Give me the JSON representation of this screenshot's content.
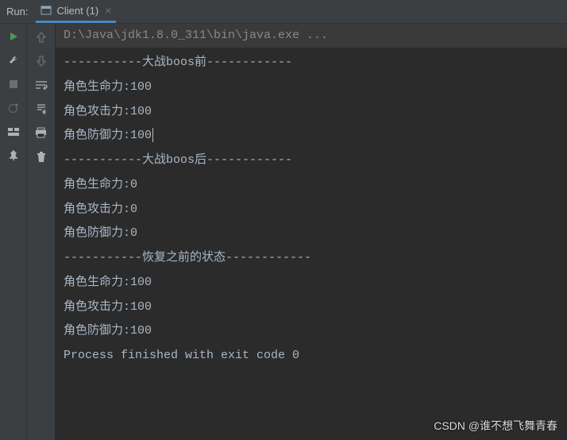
{
  "header": {
    "run_label": "Run:",
    "tab_label": "Client (1)",
    "tab_close": "×"
  },
  "console": {
    "command": "D:\\Java\\jdk1.8.0_311\\bin\\java.exe ...",
    "lines": [
      "-----------大战boos前------------",
      "角色生命力:100",
      "角色攻击力:100",
      "角色防御力:100",
      "-----------大战boos后------------",
      "角色生命力:0",
      "角色攻击力:0",
      "角色防御力:0",
      "-----------恢复之前的状态------------",
      "角色生命力:100",
      "角色攻击力:100",
      "角色防御力:100",
      "",
      "Process finished with exit code 0"
    ],
    "caret_line_index": 3
  },
  "watermark": "CSDN @谁不想飞舞青春"
}
